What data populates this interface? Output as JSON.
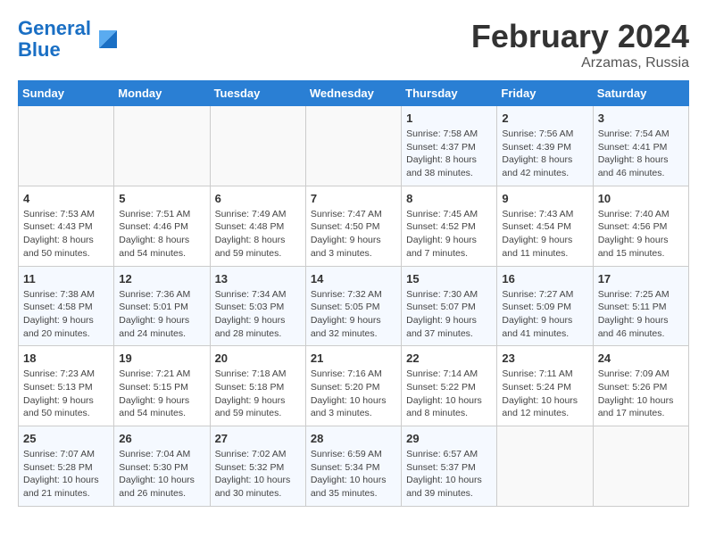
{
  "header": {
    "logo_line1": "General",
    "logo_line2": "Blue",
    "title": "February 2024",
    "subtitle": "Arzamas, Russia"
  },
  "weekdays": [
    "Sunday",
    "Monday",
    "Tuesday",
    "Wednesday",
    "Thursday",
    "Friday",
    "Saturday"
  ],
  "weeks": [
    [
      {
        "day": "",
        "info": ""
      },
      {
        "day": "",
        "info": ""
      },
      {
        "day": "",
        "info": ""
      },
      {
        "day": "",
        "info": ""
      },
      {
        "day": "1",
        "info": "Sunrise: 7:58 AM\nSunset: 4:37 PM\nDaylight: 8 hours\nand 38 minutes."
      },
      {
        "day": "2",
        "info": "Sunrise: 7:56 AM\nSunset: 4:39 PM\nDaylight: 8 hours\nand 42 minutes."
      },
      {
        "day": "3",
        "info": "Sunrise: 7:54 AM\nSunset: 4:41 PM\nDaylight: 8 hours\nand 46 minutes."
      }
    ],
    [
      {
        "day": "4",
        "info": "Sunrise: 7:53 AM\nSunset: 4:43 PM\nDaylight: 8 hours\nand 50 minutes."
      },
      {
        "day": "5",
        "info": "Sunrise: 7:51 AM\nSunset: 4:46 PM\nDaylight: 8 hours\nand 54 minutes."
      },
      {
        "day": "6",
        "info": "Sunrise: 7:49 AM\nSunset: 4:48 PM\nDaylight: 8 hours\nand 59 minutes."
      },
      {
        "day": "7",
        "info": "Sunrise: 7:47 AM\nSunset: 4:50 PM\nDaylight: 9 hours\nand 3 minutes."
      },
      {
        "day": "8",
        "info": "Sunrise: 7:45 AM\nSunset: 4:52 PM\nDaylight: 9 hours\nand 7 minutes."
      },
      {
        "day": "9",
        "info": "Sunrise: 7:43 AM\nSunset: 4:54 PM\nDaylight: 9 hours\nand 11 minutes."
      },
      {
        "day": "10",
        "info": "Sunrise: 7:40 AM\nSunset: 4:56 PM\nDaylight: 9 hours\nand 15 minutes."
      }
    ],
    [
      {
        "day": "11",
        "info": "Sunrise: 7:38 AM\nSunset: 4:58 PM\nDaylight: 9 hours\nand 20 minutes."
      },
      {
        "day": "12",
        "info": "Sunrise: 7:36 AM\nSunset: 5:01 PM\nDaylight: 9 hours\nand 24 minutes."
      },
      {
        "day": "13",
        "info": "Sunrise: 7:34 AM\nSunset: 5:03 PM\nDaylight: 9 hours\nand 28 minutes."
      },
      {
        "day": "14",
        "info": "Sunrise: 7:32 AM\nSunset: 5:05 PM\nDaylight: 9 hours\nand 32 minutes."
      },
      {
        "day": "15",
        "info": "Sunrise: 7:30 AM\nSunset: 5:07 PM\nDaylight: 9 hours\nand 37 minutes."
      },
      {
        "day": "16",
        "info": "Sunrise: 7:27 AM\nSunset: 5:09 PM\nDaylight: 9 hours\nand 41 minutes."
      },
      {
        "day": "17",
        "info": "Sunrise: 7:25 AM\nSunset: 5:11 PM\nDaylight: 9 hours\nand 46 minutes."
      }
    ],
    [
      {
        "day": "18",
        "info": "Sunrise: 7:23 AM\nSunset: 5:13 PM\nDaylight: 9 hours\nand 50 minutes."
      },
      {
        "day": "19",
        "info": "Sunrise: 7:21 AM\nSunset: 5:15 PM\nDaylight: 9 hours\nand 54 minutes."
      },
      {
        "day": "20",
        "info": "Sunrise: 7:18 AM\nSunset: 5:18 PM\nDaylight: 9 hours\nand 59 minutes."
      },
      {
        "day": "21",
        "info": "Sunrise: 7:16 AM\nSunset: 5:20 PM\nDaylight: 10 hours\nand 3 minutes."
      },
      {
        "day": "22",
        "info": "Sunrise: 7:14 AM\nSunset: 5:22 PM\nDaylight: 10 hours\nand 8 minutes."
      },
      {
        "day": "23",
        "info": "Sunrise: 7:11 AM\nSunset: 5:24 PM\nDaylight: 10 hours\nand 12 minutes."
      },
      {
        "day": "24",
        "info": "Sunrise: 7:09 AM\nSunset: 5:26 PM\nDaylight: 10 hours\nand 17 minutes."
      }
    ],
    [
      {
        "day": "25",
        "info": "Sunrise: 7:07 AM\nSunset: 5:28 PM\nDaylight: 10 hours\nand 21 minutes."
      },
      {
        "day": "26",
        "info": "Sunrise: 7:04 AM\nSunset: 5:30 PM\nDaylight: 10 hours\nand 26 minutes."
      },
      {
        "day": "27",
        "info": "Sunrise: 7:02 AM\nSunset: 5:32 PM\nDaylight: 10 hours\nand 30 minutes."
      },
      {
        "day": "28",
        "info": "Sunrise: 6:59 AM\nSunset: 5:34 PM\nDaylight: 10 hours\nand 35 minutes."
      },
      {
        "day": "29",
        "info": "Sunrise: 6:57 AM\nSunset: 5:37 PM\nDaylight: 10 hours\nand 39 minutes."
      },
      {
        "day": "",
        "info": ""
      },
      {
        "day": "",
        "info": ""
      }
    ]
  ]
}
